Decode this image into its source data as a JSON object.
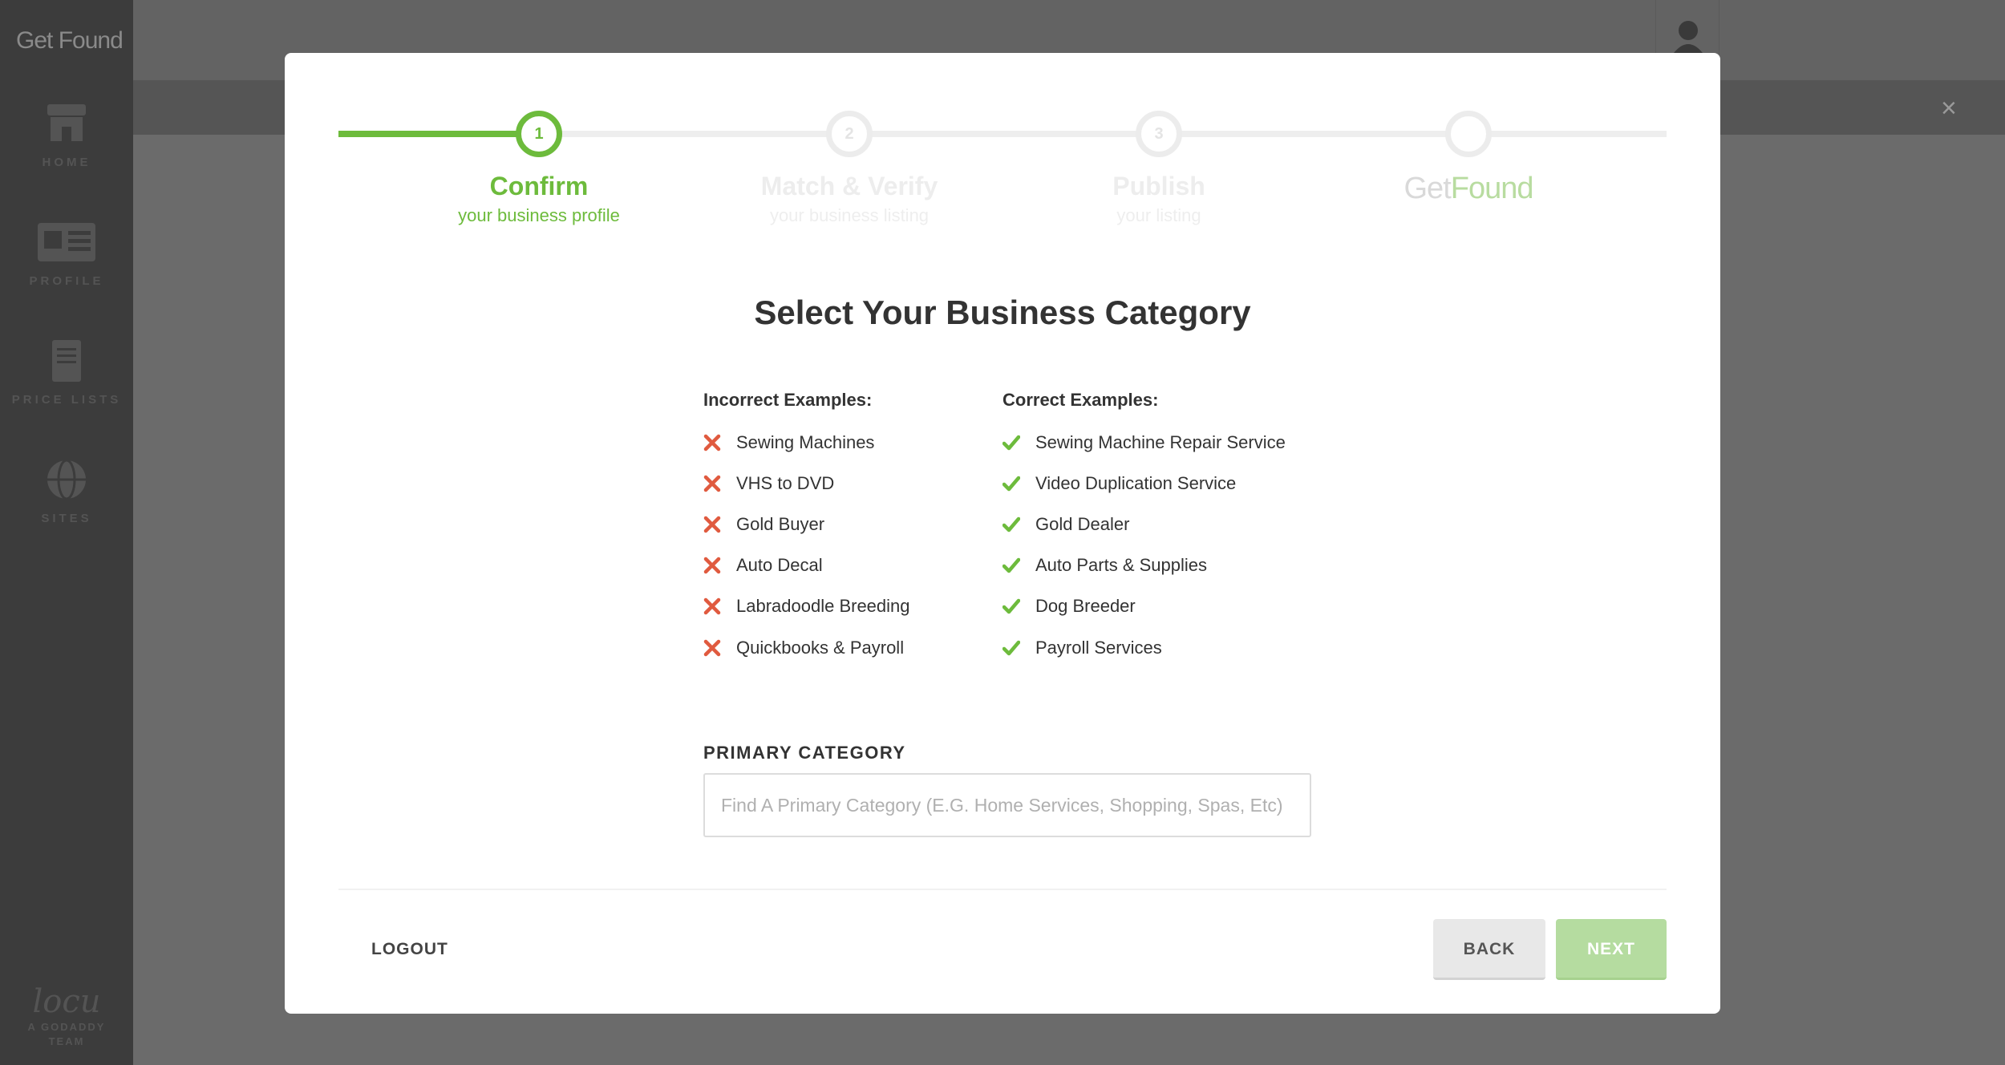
{
  "sidebar": {
    "brand": "Get Found",
    "items": [
      {
        "label": "HOME",
        "icon": "storefront-icon"
      },
      {
        "label": "PROFILE",
        "icon": "profile-card-icon"
      },
      {
        "label": "PRICE LISTS",
        "icon": "document-icon"
      },
      {
        "label": "SITES",
        "icon": "globe-icon"
      }
    ],
    "footer_logo": "locu",
    "footer_sub_1": "A GODADDY",
    "footer_sub_2": "TEAM"
  },
  "background": {
    "close_icon": "close-icon",
    "avatar_icon": "user-icon"
  },
  "wizard": {
    "steps": [
      {
        "number": "1",
        "title": "Confirm",
        "subtitle": "your business profile",
        "active": true
      },
      {
        "number": "2",
        "title": "Match & Verify",
        "subtitle": "your business listing",
        "active": false
      },
      {
        "number": "3",
        "title": "Publish",
        "subtitle": "your listing",
        "active": false
      },
      {
        "number": "",
        "title_part1": "Get",
        "title_part2": "Found",
        "active": false
      }
    ],
    "progress_fraction": 0.15
  },
  "content": {
    "heading": "Select Your Business Category",
    "incorrect_title": "Incorrect Examples:",
    "incorrect": [
      "Sewing Machines",
      "VHS to DVD",
      "Gold Buyer",
      "Auto Decal",
      "Labradoodle Breeding",
      "Quickbooks & Payroll"
    ],
    "correct_title": "Correct Examples:",
    "correct": [
      "Sewing Machine Repair Service",
      "Video Duplication Service",
      "Gold Dealer",
      "Auto Parts & Supplies",
      "Dog Breeder",
      "Payroll Services"
    ]
  },
  "form": {
    "primary_label": "PRIMARY CATEGORY",
    "primary_placeholder": "Find A Primary Category (E.G. Home Services, Shopping, Spas, Etc)",
    "primary_value": ""
  },
  "footer": {
    "logout": "LOGOUT",
    "back": "BACK",
    "next": "NEXT"
  },
  "colors": {
    "accent_green": "#6dbb3c",
    "error_red": "#e05a3f",
    "next_disabled": "#b5dca0"
  }
}
